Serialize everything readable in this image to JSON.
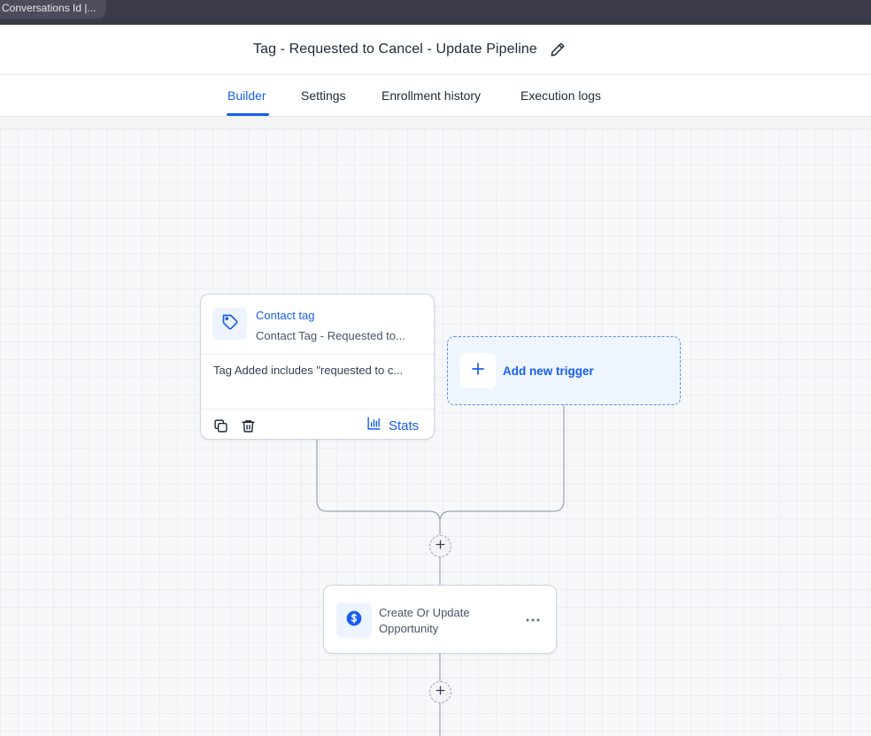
{
  "browser": {
    "tab_title": "Conversations Id |..."
  },
  "header": {
    "title": "Tag - Requested to Cancel - Update Pipeline"
  },
  "tabs": [
    {
      "label": "Builder",
      "active": true
    },
    {
      "label": "Settings"
    },
    {
      "label": "Enrollment history"
    },
    {
      "label": "Execution logs"
    }
  ],
  "trigger": {
    "title": "Contact tag",
    "subtitle": "Contact Tag - Requested to...",
    "condition": "Tag Added includes \"requested to c...",
    "stats_label": "Stats",
    "icon": "tag-icon"
  },
  "add_trigger": {
    "label": "Add new trigger"
  },
  "action": {
    "title": "Create Or Update Opportunity",
    "icon": "dollar-icon"
  },
  "colors": {
    "accent": "#155eef",
    "border": "#d0d5dd",
    "topbar": "#3b3a4a"
  }
}
